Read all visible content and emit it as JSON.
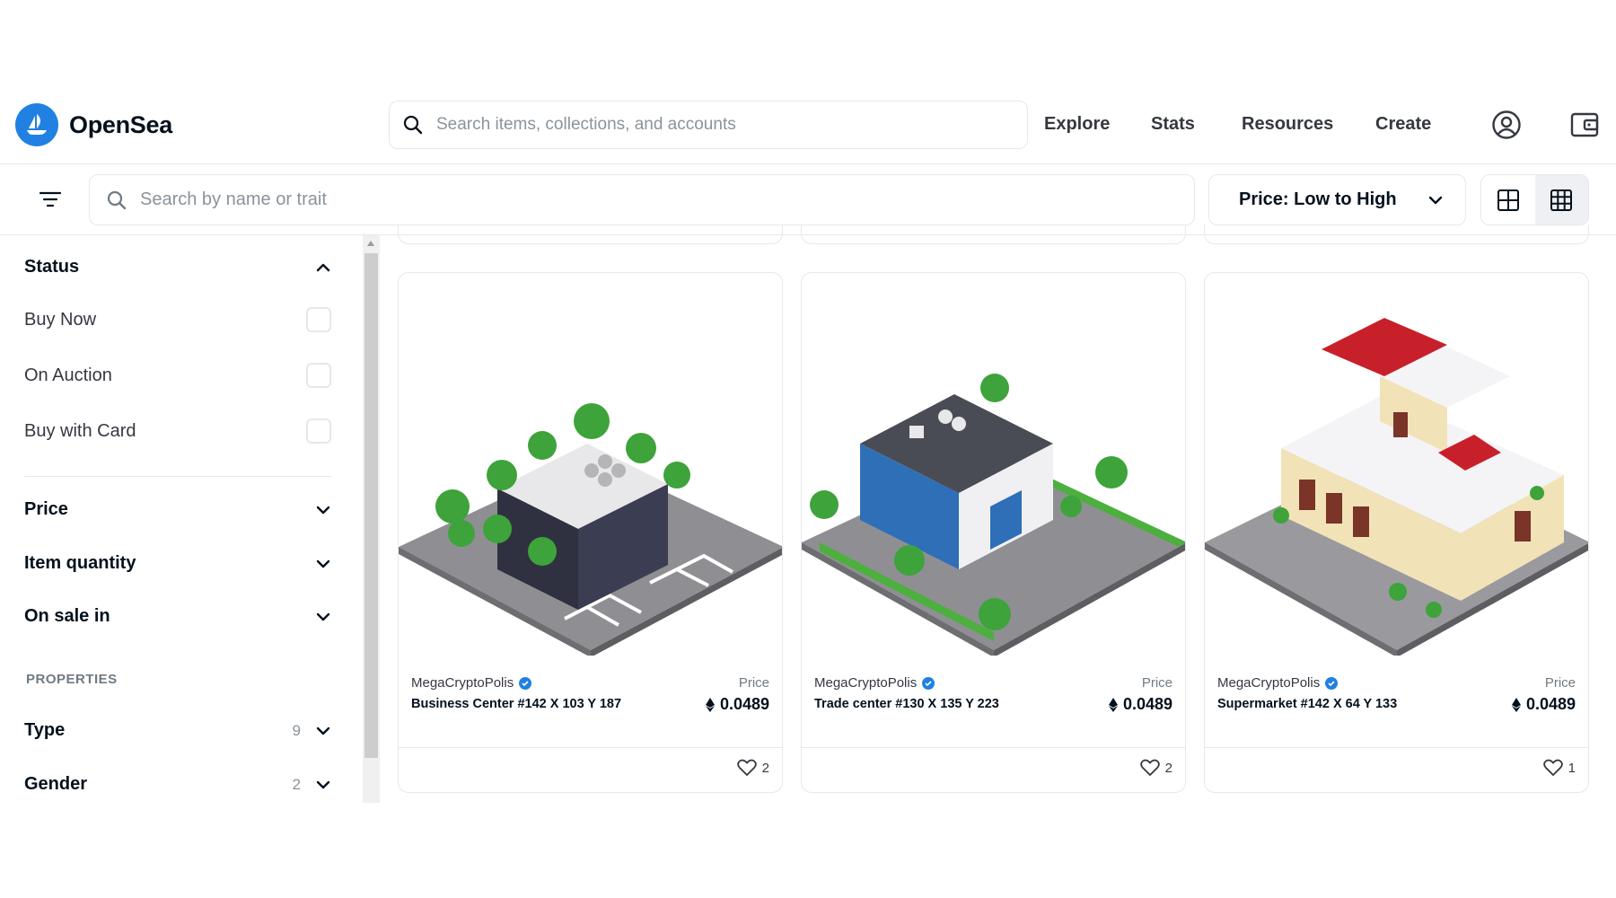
{
  "nav": {
    "logo_text": "OpenSea",
    "search_placeholder": "Search items, collections, and accounts",
    "links": [
      "Explore",
      "Stats",
      "Resources",
      "Create"
    ]
  },
  "toolbar": {
    "search_placeholder": "Search by name or trait",
    "sort_label": "Price: Low to High"
  },
  "sidebar": {
    "status": {
      "title": "Status",
      "options": [
        "Buy Now",
        "On Auction",
        "Buy with Card"
      ]
    },
    "filters": [
      "Price",
      "Item quantity",
      "On sale in"
    ],
    "properties_label": "PROPERTIES",
    "properties": [
      {
        "name": "Type",
        "count": "9"
      },
      {
        "name": "Gender",
        "count": "2"
      }
    ]
  },
  "cards": [
    {
      "collection": "MegaCryptoPolis",
      "name": "Business Center #142 X 103 Y 187",
      "price_label": "Price",
      "price": "0.0489",
      "likes": "2"
    },
    {
      "collection": "MegaCryptoPolis",
      "name": "Trade center #130 X 135 Y 223",
      "price_label": "Price",
      "price": "0.0489",
      "likes": "2"
    },
    {
      "collection": "MegaCryptoPolis",
      "name": "Supermarket #142 X 64 Y 133",
      "price_label": "Price",
      "price": "0.0489",
      "likes": "1"
    }
  ],
  "colors": {
    "brand": "#2081e2",
    "text": "#04111d",
    "border": "#e5e8eb"
  }
}
